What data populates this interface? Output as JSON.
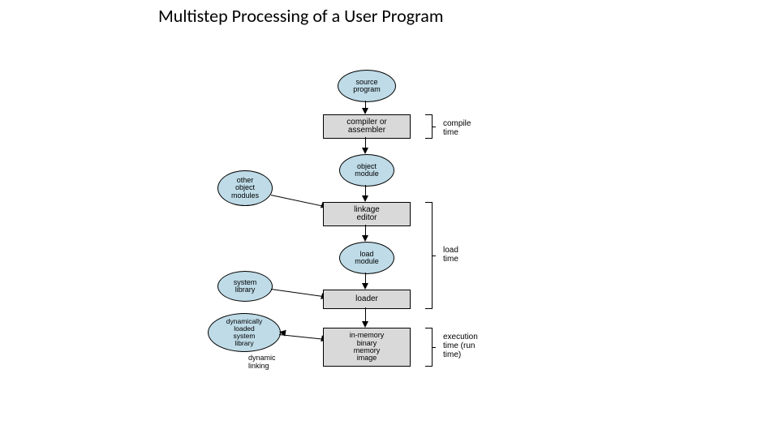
{
  "title": "Multistep Processing of a User Program",
  "nodes": {
    "source_program": "source\nprogram",
    "compiler": "compiler or\nassembler",
    "object_module": "object\nmodule",
    "other_object": "other\nobject\nmodules",
    "linkage_editor": "linkage\neditor",
    "load_module": "load\nmodule",
    "system_library": "system\nlibrary",
    "loader": "loader",
    "dyn_library": "dynamically\nloaded\nsystem\nlibrary",
    "memory_image": "in-memory\nbinary\nmemory\nimage"
  },
  "labels": {
    "dynamic_linking": "dynamic\nlinking"
  },
  "phases": {
    "compile": "compile\ntime",
    "load": "load\ntime",
    "execution": "execution\ntime (run\ntime)"
  }
}
